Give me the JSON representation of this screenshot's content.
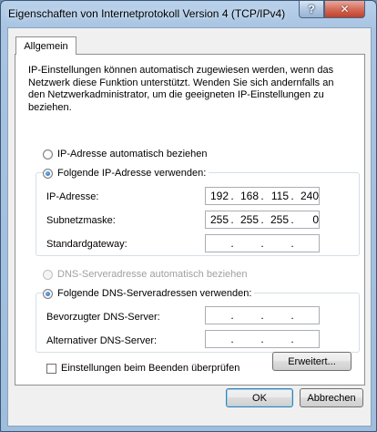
{
  "window": {
    "title": "Eigenschaften von Internetprotokoll Version 4 (TCP/IPv4)",
    "help_label": "?",
    "close_label": "✕"
  },
  "tabs": [
    {
      "label": "Allgemein"
    }
  ],
  "intro_text": "IP-Einstellungen können automatisch zugewiesen werden, wenn das Netzwerk diese Funktion unterstützt. Wenden Sie sich andernfalls an den Netzwerkadministrator, um die geeigneten IP-Einstellungen zu beziehen.",
  "ip": {
    "auto_label": "IP-Adresse automatisch beziehen",
    "manual_label": "Folgende IP-Adresse verwenden:",
    "selected": "manual",
    "fields": {
      "address": {
        "label": "IP-Adresse:",
        "octets": [
          "192",
          "168",
          "115",
          "240"
        ]
      },
      "subnet": {
        "label": "Subnetzmaske:",
        "octets": [
          "255",
          "255",
          "255",
          "0"
        ]
      },
      "gateway": {
        "label": "Standardgateway:",
        "octets": [
          "",
          "",
          "",
          ""
        ]
      }
    }
  },
  "dns": {
    "auto_label": "DNS-Serveradresse automatisch beziehen",
    "manual_label": "Folgende DNS-Serveradressen verwenden:",
    "selected": "manual",
    "fields": {
      "preferred": {
        "label": "Bevorzugter DNS-Server:",
        "octets": [
          "",
          "",
          "",
          ""
        ]
      },
      "alternate": {
        "label": "Alternativer DNS-Server:",
        "octets": [
          "",
          "",
          "",
          ""
        ]
      }
    }
  },
  "validate_label": "Einstellungen beim Beenden überprüfen",
  "validate_checked": false,
  "buttons": {
    "advanced": "Erweitert...",
    "ok": "OK",
    "cancel": "Abbrechen"
  }
}
